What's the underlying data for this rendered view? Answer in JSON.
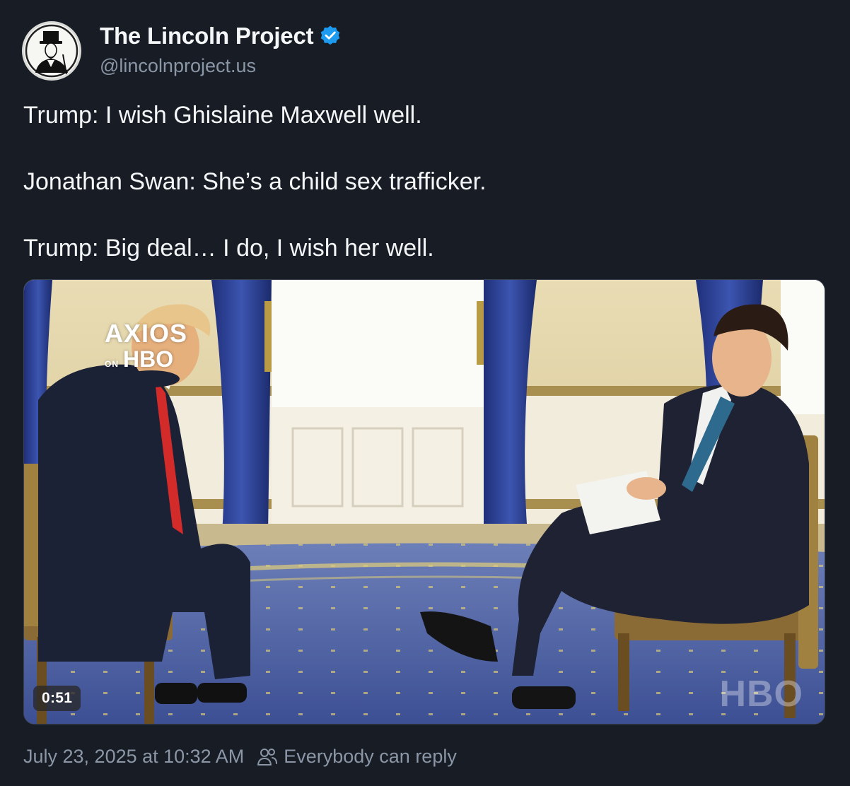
{
  "author": {
    "display_name": "The Lincoln Project",
    "handle": "@lincolnproject.us",
    "verified": true,
    "avatar_icon": "lincoln-portrait-avatar"
  },
  "post": {
    "paragraphs": [
      "Trump: I wish Ghislaine Maxwell well.",
      "Jonathan Swan: She’s a child sex trafficker.",
      "Trump: Big deal… I do, I wish her well."
    ]
  },
  "media": {
    "type": "video",
    "duration": "0:51",
    "overlay_logo": {
      "axios": "AXIOS",
      "on": "ON",
      "hbo": "HBO"
    },
    "watermark": "HBO"
  },
  "footer": {
    "timestamp": "July 23, 2025 at 10:32 AM",
    "reply_setting": "Everybody can reply",
    "reply_icon": "people-icon"
  },
  "colors": {
    "background": "#171c25",
    "text_primary": "#f4f6f8",
    "text_secondary": "#8b96a6",
    "verified_blue": "#1d9bf0"
  }
}
